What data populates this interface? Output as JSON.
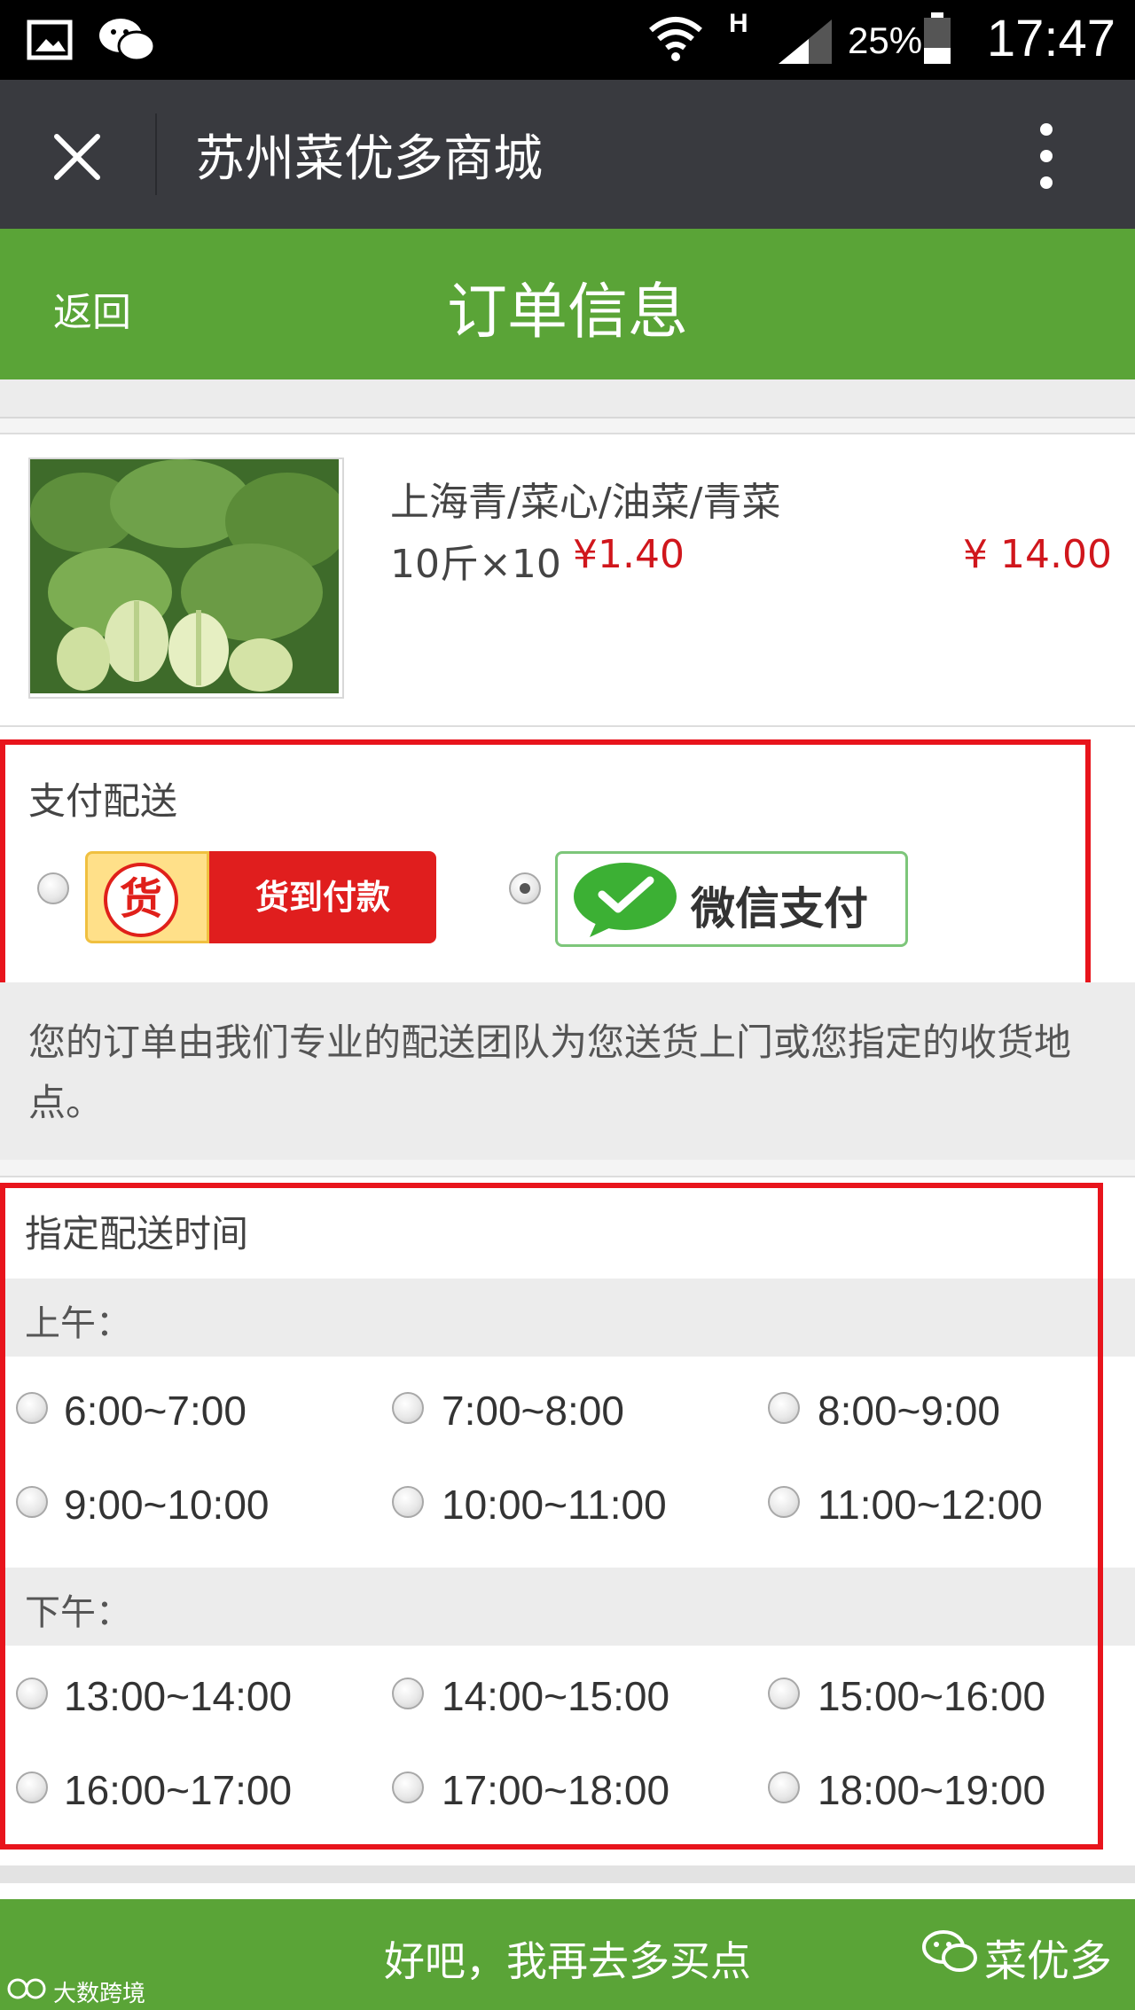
{
  "status_bar": {
    "network": "H",
    "battery_percent": "25%",
    "time": "17:47"
  },
  "wechat_header": {
    "title": "苏州菜优多商城"
  },
  "page_header": {
    "back_label": "返回",
    "title": "订单信息"
  },
  "product": {
    "name": "上海青/菜心/油菜/青菜",
    "quantity": "10斤×10",
    "unit_price": "¥1.40",
    "total_price": "¥ 14.00"
  },
  "payment": {
    "section_label": "支付配送",
    "options": [
      {
        "badge_glyph": "货",
        "label": "货到付款",
        "selected": false
      },
      {
        "label": "微信支付",
        "selected": true
      }
    ],
    "delivery_note": "您的订单由我们专业的配送团队为您送货上门或您指定的收货地点。"
  },
  "delivery_time": {
    "section_label": "指定配送时间",
    "periods": [
      {
        "label": "上午：",
        "slots": [
          "6:00~7:00",
          "7:00~8:00",
          "8:00~9:00",
          "9:00~10:00",
          "10:00~11:00",
          "11:00~12:00"
        ]
      },
      {
        "label": "下午：",
        "slots": [
          "13:00~14:00",
          "14:00~15:00",
          "15:00~16:00",
          "16:00~17:00",
          "17:00~18:00",
          "18:00~19:00"
        ]
      }
    ]
  },
  "cta": {
    "label": "好吧，我再去多买点"
  },
  "overlay": {
    "brand": "菜优多",
    "watermark": "大数跨境"
  },
  "colors": {
    "green": "#5aa437",
    "price_red": "#d0161c",
    "highlight_red": "#e8141c",
    "wechat_dark": "#393a3f"
  }
}
